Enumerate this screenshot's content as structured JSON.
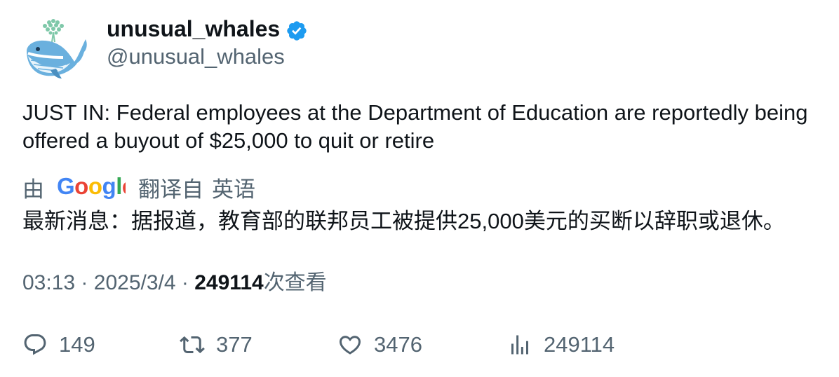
{
  "author": {
    "display_name": "unusual_whales",
    "handle": "@unusual_whales",
    "verified": true,
    "avatar_icon": "whale-icon"
  },
  "tweet": {
    "text": "JUST IN: Federal employees at the Department of Education are reportedly being offered a buyout of $25,000 to quit or retire"
  },
  "translation": {
    "by_label": "由",
    "provider": "Google",
    "from_label": "翻译自",
    "language": "英语",
    "text": "最新消息：据报道，教育部的联邦员工被提供25,000美元的买断以辞职或退休。"
  },
  "meta": {
    "time": "03:13",
    "separator": "·",
    "date": "2025/3/4",
    "views_count": "249114",
    "views_label": "次查看"
  },
  "actions": {
    "replies": "149",
    "retweets": "377",
    "likes": "3476",
    "views": "249114"
  },
  "colors": {
    "text_primary": "#0f1419",
    "text_secondary": "#536471",
    "verified_blue": "#1d9bf0",
    "google_blue": "#4285f4",
    "google_red": "#ea4335",
    "google_yellow": "#fbbc05",
    "google_green": "#34a853"
  }
}
